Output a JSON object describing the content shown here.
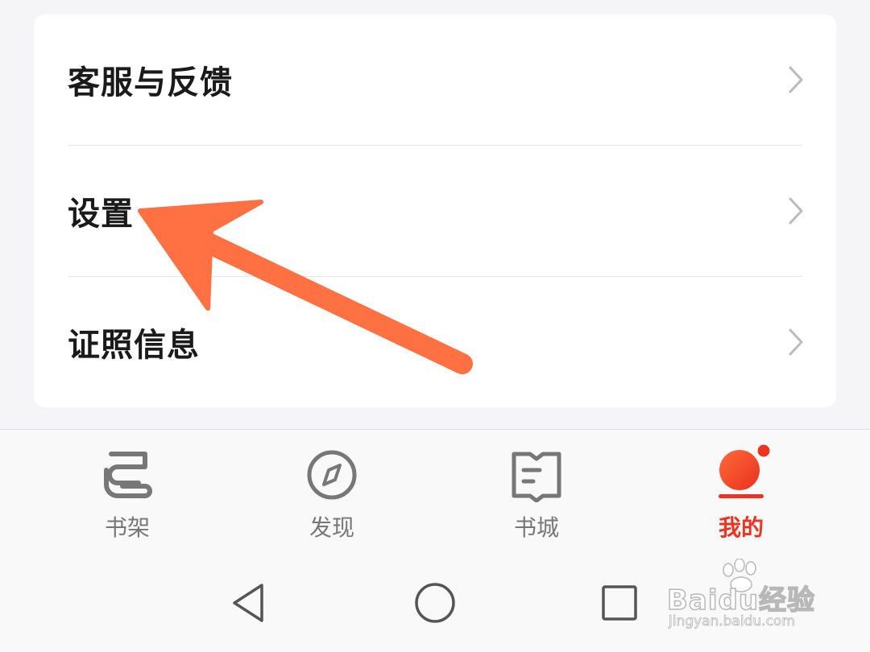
{
  "menu": {
    "items": [
      {
        "label": "客服与反馈"
      },
      {
        "label": "设置"
      },
      {
        "label": "证照信息"
      }
    ]
  },
  "tabbar": {
    "tabs": [
      {
        "label": "书架",
        "icon": "bookshelf-icon",
        "active": false
      },
      {
        "label": "发现",
        "icon": "compass-icon",
        "active": false
      },
      {
        "label": "书城",
        "icon": "book-icon",
        "active": false
      },
      {
        "label": "我的",
        "icon": "profile-icon",
        "active": true,
        "badge_dot": true
      }
    ]
  },
  "system_nav": {
    "buttons": [
      "back-icon",
      "home-icon",
      "recents-icon"
    ]
  },
  "watermark": {
    "logo_text": "Baidu经验",
    "url": "jingyan.baidu.com"
  },
  "colors": {
    "accent": "#ee3322",
    "annotation_arrow": "#ff7043",
    "text_primary": "#1a1a1a",
    "tab_inactive": "#777777",
    "chevron": "#bbbbbb"
  }
}
